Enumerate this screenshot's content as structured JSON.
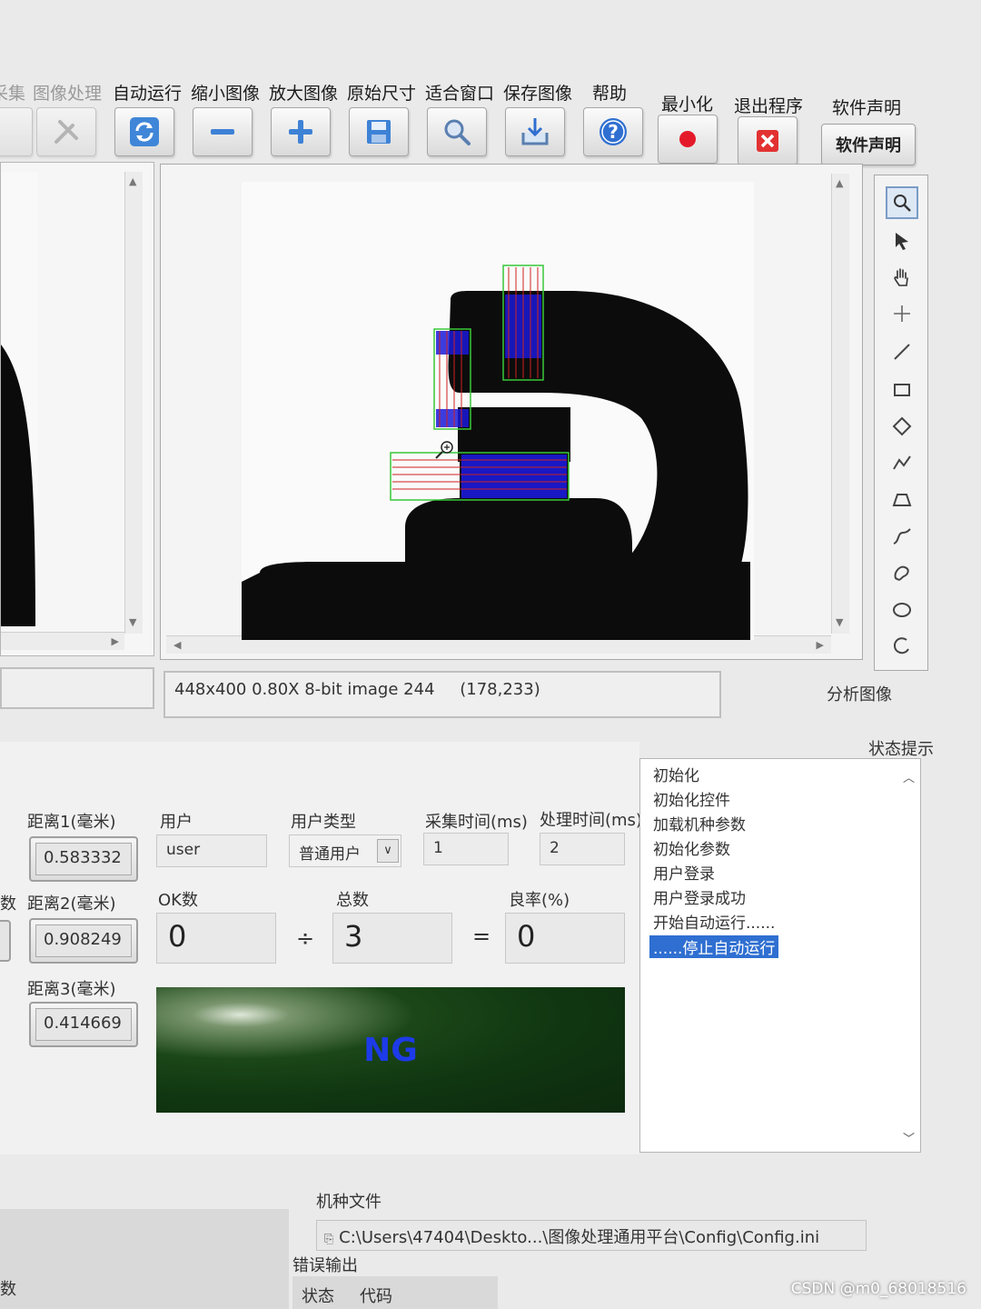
{
  "toolbar": {
    "items": [
      {
        "label": "采集",
        "icon": "blank",
        "dim": true
      },
      {
        "label": "图像处理",
        "icon": "tools-icon",
        "dim": true
      },
      {
        "label": "自动运行",
        "icon": "refresh-icon",
        "dim": false
      },
      {
        "label": "缩小图像",
        "icon": "minus-icon",
        "dim": false
      },
      {
        "label": "放大图像",
        "icon": "plus-icon",
        "dim": false
      },
      {
        "label": "原始尺寸",
        "icon": "save-icon",
        "dim": false
      },
      {
        "label": "适合窗口",
        "icon": "magnifier-icon",
        "dim": false
      },
      {
        "label": "保存图像",
        "icon": "export-icon",
        "dim": false
      },
      {
        "label": "帮助",
        "icon": "help-icon",
        "dim": false
      },
      {
        "label": "最小化",
        "icon": "record-icon",
        "dim": false
      },
      {
        "label": "退出程序",
        "icon": "close-icon",
        "dim": false
      }
    ],
    "declaration_label": "软件声明",
    "declaration_button": "软件声明"
  },
  "image_status": {
    "info": "448x400 0.80X 8-bit image 244",
    "coords": "(178,233)"
  },
  "analyze_label": "分析图像",
  "status_hint_label": "状态提示",
  "measurements": {
    "dist1_label": "距离1(毫米)",
    "dist1": "0.583332",
    "dist2_label": "距离2(毫米)",
    "dist2": "0.908249",
    "dist3_label": "距离3(毫米)",
    "dist3": "0.414669"
  },
  "user": {
    "user_label": "用户",
    "user_value": "user",
    "type_label": "用户类型",
    "type_value": "普通用户",
    "capture_label": "采集时间(ms)",
    "capture_value": "1",
    "process_label": "处理时间(ms)",
    "process_value": "2"
  },
  "stats": {
    "ok_label": "OK数",
    "ok_value": "0",
    "divide": "÷",
    "total_label": "总数",
    "total_value": "3",
    "equals": "=",
    "rate_label": "良率(%)",
    "rate_value": "0"
  },
  "result": {
    "text": "NG",
    "color": "#1d3be8"
  },
  "log": {
    "items": [
      "初始化",
      "初始化控件",
      "加载机种参数",
      "初始化参数",
      "用户登录",
      "用户登录成功",
      "开始自动运行......",
      "......停止自动运行"
    ],
    "selected_index": 7
  },
  "model_file": {
    "label": "机种文件",
    "path": "C:\\Users\\47404\\Deskto...\\图像处理通用平台\\Config\\Config.ini"
  },
  "error_output": {
    "label": "错误输出",
    "col_status": "状态",
    "col_code": "代码"
  },
  "left_edge_text": {
    "shu": "数",
    "param": "数"
  },
  "watermark": "CSDN @m0_68018516",
  "colors": {
    "selection": "#2f6fd1",
    "ng_text": "#1d3be8",
    "ng_bg": "#0f3a12",
    "roi_blue": "#1a1ad8",
    "roi_red": "#d02020",
    "roi_green": "#39c839"
  }
}
